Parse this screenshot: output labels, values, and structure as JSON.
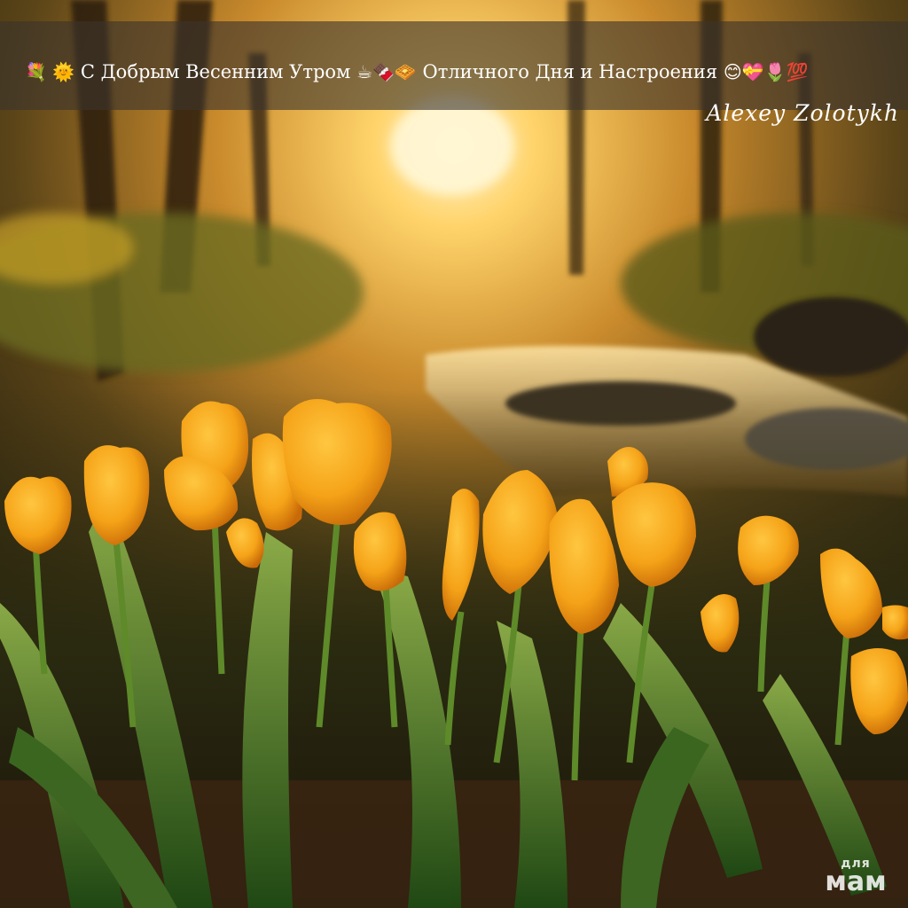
{
  "banner": {
    "emoji_start": "💐 🌞",
    "text_greeting": "С Добрым Весенним Утром",
    "emoji_middle": "☕🍫🧇",
    "text_wish": "Отличного Дня и Настроения",
    "emoji_end": "😊💝🌷💯"
  },
  "author": "Alexey Zolotykh",
  "watermark": {
    "line1": "для",
    "line2": "мам"
  },
  "colors": {
    "tulip": "#f5a318",
    "sun": "#ffe08a",
    "banner_bg": "#3c342c"
  }
}
